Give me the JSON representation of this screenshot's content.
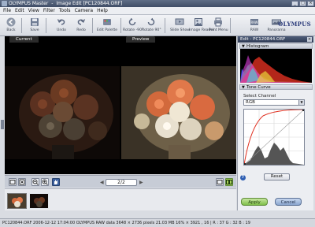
{
  "window": {
    "app_name": "OLYMPUS Master",
    "separator": "-",
    "document_title": "Image Edit [PC120844.ORF]",
    "controls": [
      "_",
      "□",
      "×"
    ]
  },
  "menu": [
    "File",
    "Edit",
    "View",
    "Filter",
    "Tools",
    "Camera",
    "Help"
  ],
  "toolbar": {
    "back": "Back",
    "save": "Save",
    "undo": "Undo",
    "redo": "Redo",
    "edit_palette": "Edit Palette",
    "rotate_left": "Rotate -90°",
    "rotate_right": "Rotate 90°",
    "slide_show": "Slide Show",
    "image_reader": "Image Reader",
    "print_menu": "Print Menu",
    "raw": "RAW",
    "panorama": "Panorama",
    "logo": "OLYMPUS"
  },
  "view": {
    "current_tab": "Current",
    "preview_tab": "Preview",
    "page": "2/2"
  },
  "panel": {
    "title": "Edit - PC120844.ORF",
    "close": "×",
    "histogram_header": "Histogram",
    "tone_curve_header": "Tone Curve",
    "select_channel_label": "Select Channel",
    "selected_channel": "RGB",
    "reset": "Reset",
    "help": "?",
    "apply": "Apply",
    "cancel": "Cancel"
  },
  "status": {
    "text": "PC120844.ORF   2006-12-12 17:04:00   OLYMPUS RAW data   3648 × 2736 pixels   21.03 MB   16% ×   3921 , 16   |   R : 37  G : 32  B : 19"
  }
}
